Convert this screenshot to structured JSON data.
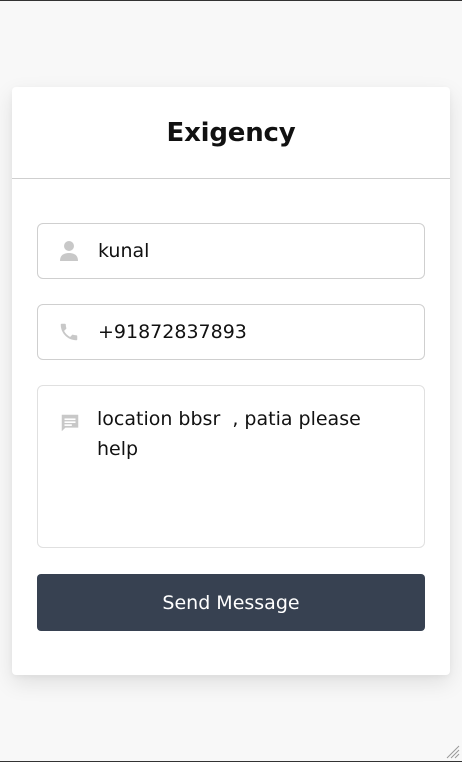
{
  "app": {
    "title": "Exigency"
  },
  "form": {
    "name": {
      "value": "kunal",
      "icon": "person-icon"
    },
    "phone": {
      "value": "+91872837893",
      "icon": "phone-icon"
    },
    "message": {
      "value": "location bbsr  , patia please help",
      "icon": "message-icon"
    },
    "submit_label": "Send Message"
  },
  "colors": {
    "button_bg": "#374151",
    "icon": "#c8c8c8",
    "border": "#cfcfcf"
  }
}
